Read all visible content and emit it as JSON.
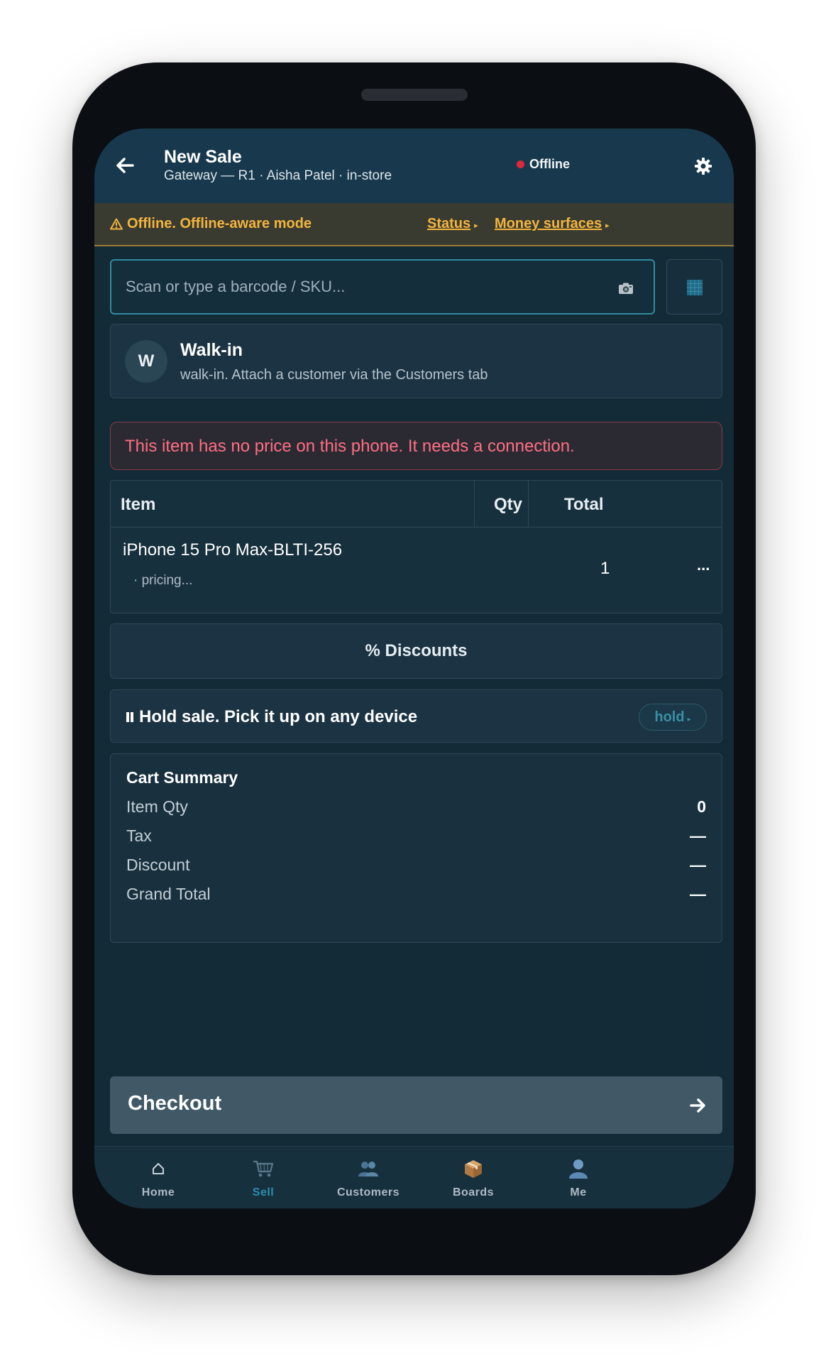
{
  "header": {
    "title": "New Sale",
    "subtitle": "Gateway — R1 · Aisha Patel · in-store",
    "status": "Offline"
  },
  "banner": {
    "message": "Offline. Offline-aware mode",
    "links": [
      "Status",
      "Money surfaces"
    ]
  },
  "scan": {
    "placeholder": "Scan or type a barcode / SKU..."
  },
  "customer": {
    "initial": "W",
    "name": "Walk-in",
    "note": "walk-in. Attach a customer via the Customers tab"
  },
  "error": "This item has no price on this phone. It needs a connection.",
  "table": {
    "headers": {
      "item": "Item",
      "qty": "Qty",
      "total": "Total"
    },
    "rows": [
      {
        "name": "iPhone 15 Pro Max-BLTI-256",
        "sub": "· pricing...",
        "qty": "1",
        "total": "..."
      }
    ]
  },
  "discounts_label": "% Discounts",
  "hold": {
    "label": "Hold sale. Pick it up on any device",
    "chip": "hold"
  },
  "summary": {
    "title": "Cart Summary",
    "rows": [
      {
        "label": "Item Qty",
        "value": "0"
      },
      {
        "label": "Tax",
        "value": "—"
      },
      {
        "label": "Discount",
        "value": "—"
      },
      {
        "label": "Grand Total",
        "value": "—"
      }
    ]
  },
  "checkout_label": "Checkout",
  "tabs": [
    {
      "label": "Home",
      "icon": "home-icon"
    },
    {
      "label": "Sell",
      "icon": "cart-icon",
      "active": true
    },
    {
      "label": "Customers",
      "icon": "people-icon"
    },
    {
      "label": "Boards",
      "icon": "box-icon"
    },
    {
      "label": "Me",
      "icon": "person-icon"
    }
  ],
  "colors": {
    "header_bg": "#18394d",
    "warning": "#f2b43e",
    "error": "#ff6f82",
    "status_dot": "#e0283a",
    "accent": "#2a8fb0",
    "checkout_bg": "#415967"
  }
}
